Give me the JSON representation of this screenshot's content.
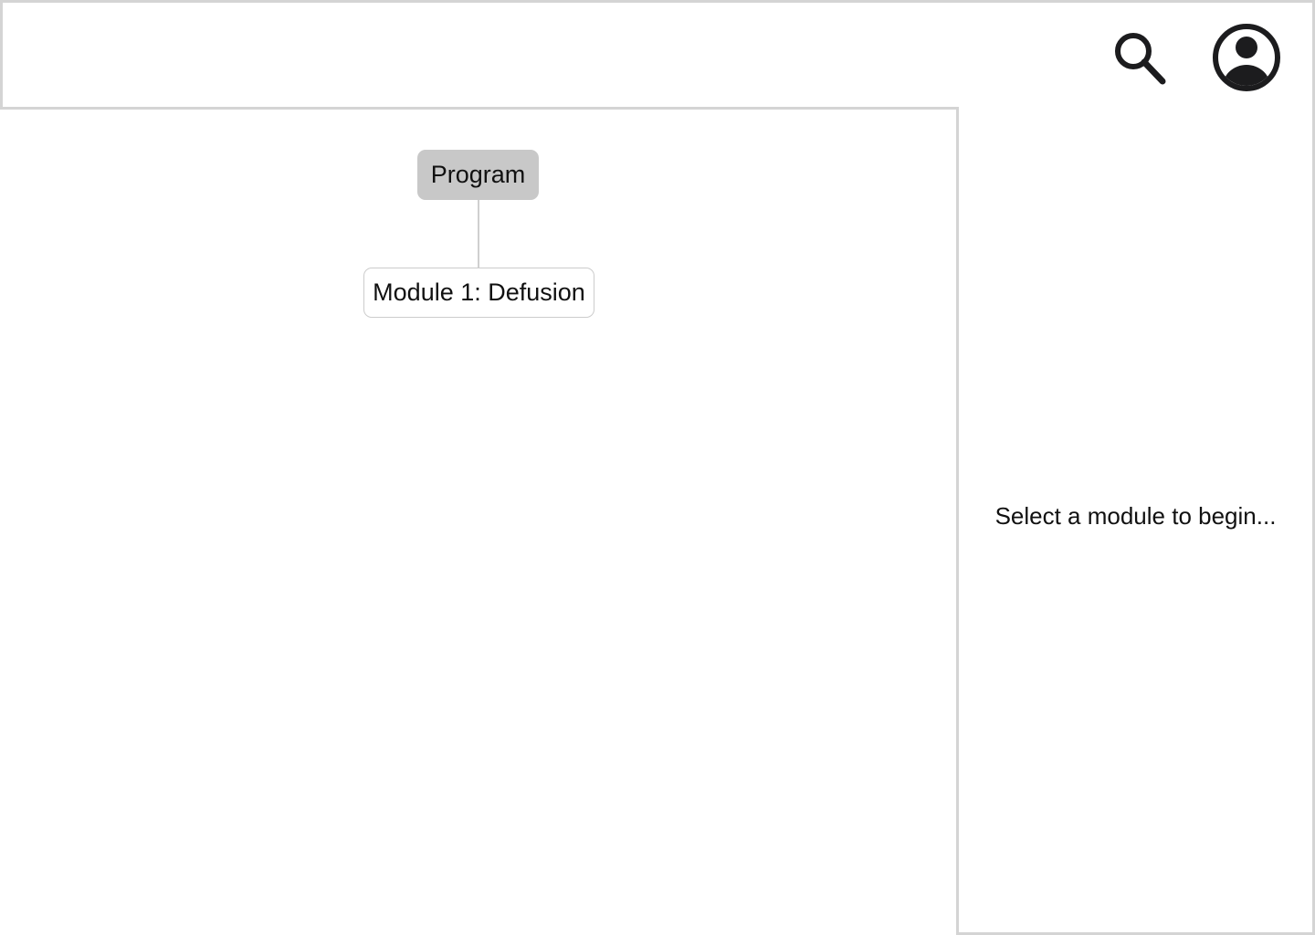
{
  "header": {
    "search_icon": "search-icon",
    "account_icon": "account-circle-icon",
    "icon_color": "#1c1c1e"
  },
  "tree": {
    "root_label": "Program",
    "root_color": "#c8c8c8",
    "modules": [
      {
        "label": "Module 1: Defusion"
      }
    ],
    "connector_color": "#cfcfcf"
  },
  "side_panel": {
    "hint": "Select a module to begin..."
  },
  "colors": {
    "border": "#d4d4d4",
    "background": "#ffffff",
    "text": "#111111"
  }
}
